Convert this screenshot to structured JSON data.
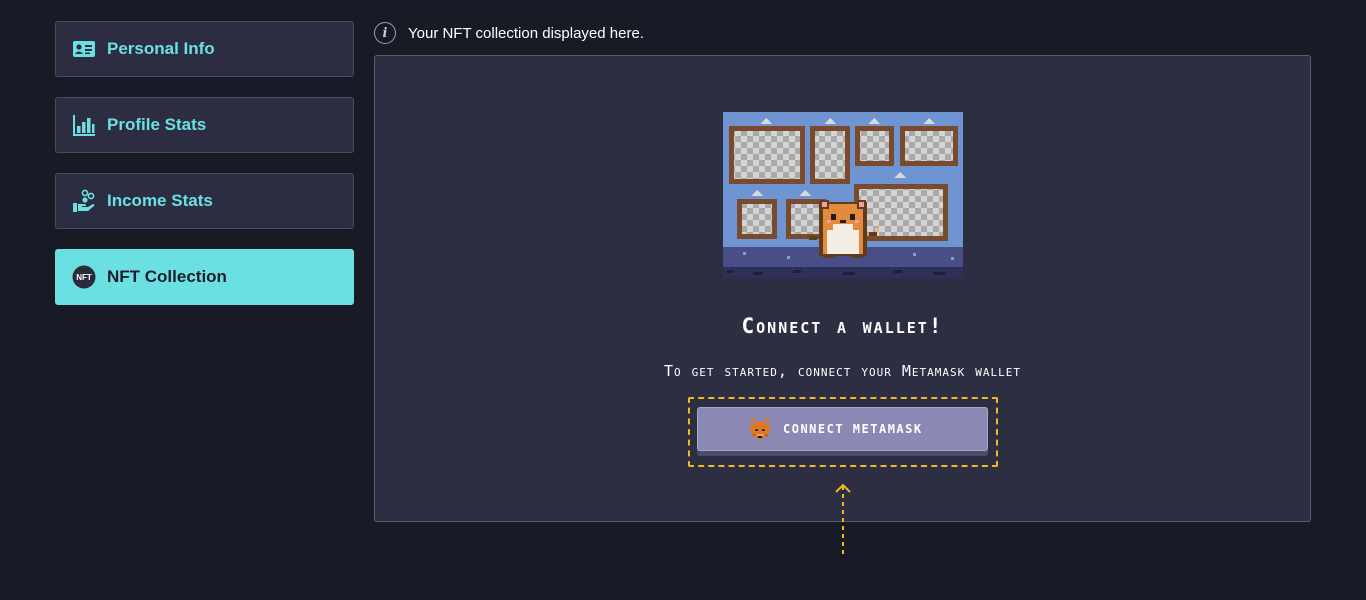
{
  "sidebar": {
    "items": [
      {
        "label": "Personal Info",
        "icon": "id-card-icon",
        "active": false
      },
      {
        "label": "Profile Stats",
        "icon": "bar-chart-icon",
        "active": false
      },
      {
        "label": "Income Stats",
        "icon": "income-hand-icon",
        "active": false
      },
      {
        "label": "NFT Collection",
        "icon": "nft-badge-icon",
        "active": true
      }
    ],
    "nft_badge_text": "NFT"
  },
  "info": {
    "icon": "info-icon",
    "glyph": "i",
    "text": "Your NFT collection displayed here."
  },
  "panel": {
    "title": "Connect a wallet!",
    "subtitle": "To get started, connect your Metamask wallet",
    "button_label": "CONNECT METAMASK",
    "button_icon": "metamask-fox-icon"
  },
  "colors": {
    "accent": "#6be0e3",
    "background": "#181a26",
    "panel": "#2d2e42",
    "button": "#8c88b4",
    "highlight": "#f2b824"
  }
}
